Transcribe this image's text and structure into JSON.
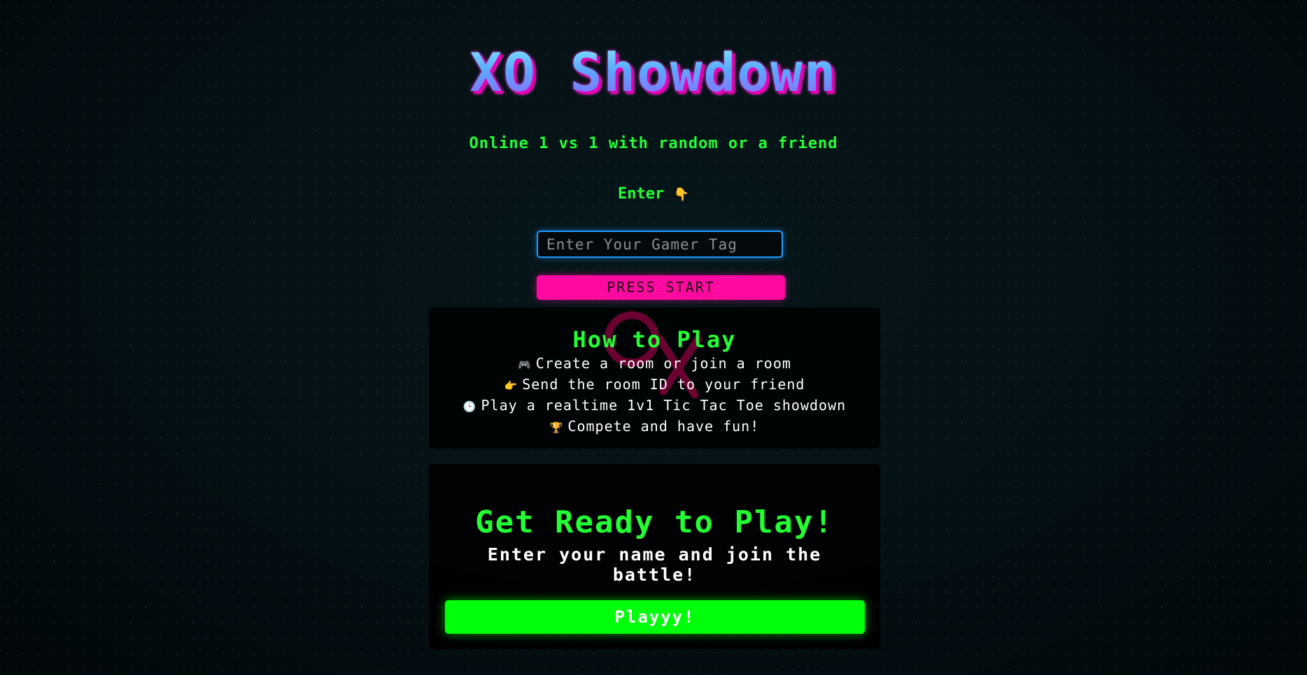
{
  "header": {
    "title": "XO Showdown",
    "subtitle": "Online 1 vs 1 with random or a friend"
  },
  "entry": {
    "prompt_label": "Enter",
    "prompt_emoji": "👇",
    "gamer_tag_placeholder": "Enter Your Gamer Tag",
    "gamer_tag_value": "",
    "start_button_label": "PRESS START"
  },
  "how_to_play": {
    "title": "How to Play",
    "steps": [
      {
        "emoji": "🎮",
        "text": "Create a room or join a room"
      },
      {
        "emoji": "👉",
        "text": "Send the room ID to your friend"
      },
      {
        "emoji": "🕒",
        "text": "Play a realtime 1v1 Tic Tac Toe showdown"
      },
      {
        "emoji": "🏆",
        "text": "Compete and have fun!"
      }
    ]
  },
  "ready": {
    "title": "Get Ready to Play!",
    "text": "Enter your name and join the battle!",
    "play_button_label": "Playyy!"
  },
  "colors": {
    "neon_green": "#22ff33",
    "neon_pink": "#ff0aa1",
    "neon_blue": "#1e9bff",
    "background": "#041013"
  }
}
